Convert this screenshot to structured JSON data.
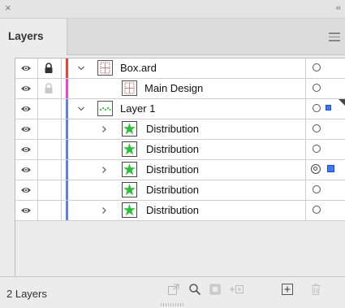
{
  "window": {
    "close_glyph": "×",
    "collapse_glyph": "‹‹"
  },
  "tab": {
    "label": "Layers"
  },
  "status": {
    "count_label": "2 Layers"
  },
  "colors": {
    "red_bar": "#ff3b30",
    "magenta_bar": "#ff3bd4",
    "blue_bar": "#5b7ff0",
    "selection": "#3b78ff",
    "star_green": "#2bbf3a"
  },
  "rows": [
    {
      "label": "Box.ard",
      "locked": true,
      "expanded": true,
      "target": "single",
      "selected": false
    },
    {
      "label": "Main Design",
      "locked": true,
      "expanded": null,
      "target": "single",
      "selected": false
    },
    {
      "label": "Layer 1",
      "locked": false,
      "expanded": true,
      "target": "single",
      "selected": true
    },
    {
      "label": "Distribution",
      "locked": false,
      "expanded": false,
      "target": "single",
      "selected": false
    },
    {
      "label": "Distribution",
      "locked": false,
      "expanded": null,
      "target": "single",
      "selected": false
    },
    {
      "label": "Distribution",
      "locked": false,
      "expanded": false,
      "target": "double",
      "selected": true
    },
    {
      "label": "Distribution",
      "locked": false,
      "expanded": null,
      "target": "single",
      "selected": false
    },
    {
      "label": "Distribution",
      "locked": false,
      "expanded": false,
      "target": "single",
      "selected": false
    }
  ],
  "footer_icons": [
    "export-icon",
    "locate-object-icon",
    "make-clipping-mask-icon",
    "collect-in-new-layer-icon",
    "create-new-layer-icon",
    "delete-icon"
  ]
}
